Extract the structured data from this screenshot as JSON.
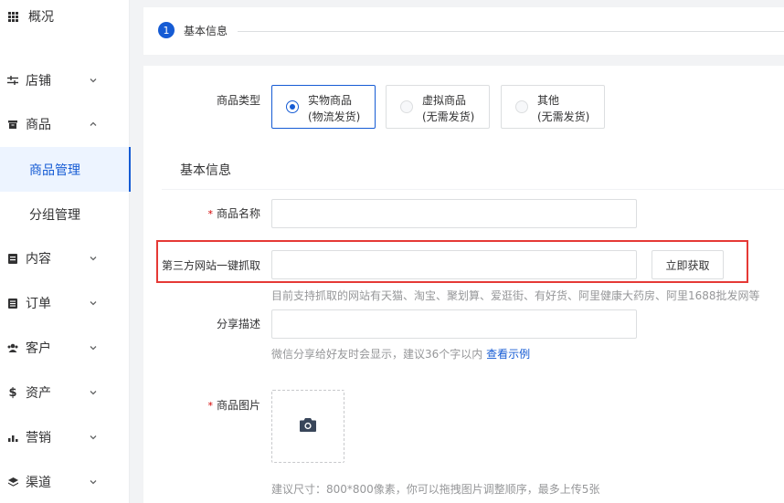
{
  "sidebar": {
    "items": [
      {
        "label": "概况",
        "icon": "dashboard-grid-icon",
        "has_chevron": false
      },
      {
        "label": "店铺",
        "icon": "shop-settings-icon",
        "has_chevron": true,
        "expanded": false
      },
      {
        "label": "商品",
        "icon": "goods-box-icon",
        "has_chevron": true,
        "expanded": true,
        "children": [
          {
            "label": "商品管理",
            "active": true
          },
          {
            "label": "分组管理",
            "active": false
          }
        ]
      },
      {
        "label": "内容",
        "icon": "content-doc-icon",
        "has_chevron": true,
        "expanded": false
      },
      {
        "label": "订单",
        "icon": "order-list-icon",
        "has_chevron": true,
        "expanded": false
      },
      {
        "label": "客户",
        "icon": "customers-icon",
        "has_chevron": true,
        "expanded": false
      },
      {
        "label": "资产",
        "icon": "dollar-icon",
        "has_chevron": true,
        "expanded": false
      },
      {
        "label": "营销",
        "icon": "bar-chart-icon",
        "has_chevron": true,
        "expanded": false
      },
      {
        "label": "渠道",
        "icon": "layers-icon",
        "has_chevron": true,
        "expanded": false
      }
    ]
  },
  "steps": {
    "number": "1",
    "title": "基本信息"
  },
  "form": {
    "product_type": {
      "label": "商品类型",
      "options": [
        {
          "title": "实物商品",
          "sub": "(物流发货)",
          "checked": true
        },
        {
          "title": "虚拟商品",
          "sub": "(无需发货)",
          "checked": false
        },
        {
          "title": "其他",
          "sub": "(无需发货)",
          "checked": false
        }
      ]
    },
    "section_title": "基本信息",
    "name": {
      "required_mark": "*",
      "label": "商品名称",
      "value": ""
    },
    "grab": {
      "label": "第三方网站一键抓取",
      "value": "",
      "button_label": "立即获取",
      "help": "目前支持抓取的网站有天猫、淘宝、聚划算、爱逛街、有好货、阿里健康大药房、阿里1688批发网等"
    },
    "share": {
      "label": "分享描述",
      "value": "",
      "help": "微信分享给好友时会显示，建议36个字以内",
      "help_link": "查看示例"
    },
    "images": {
      "required_mark": "*",
      "label": "商品图片",
      "upload_icon": "camera-icon",
      "help": "建议尺寸：800*800像素，你可以拖拽图片调整顺序，最多上传5张"
    }
  },
  "colors": {
    "accent": "#155bd4",
    "highlight": "#e53935",
    "required": "#d40000"
  }
}
